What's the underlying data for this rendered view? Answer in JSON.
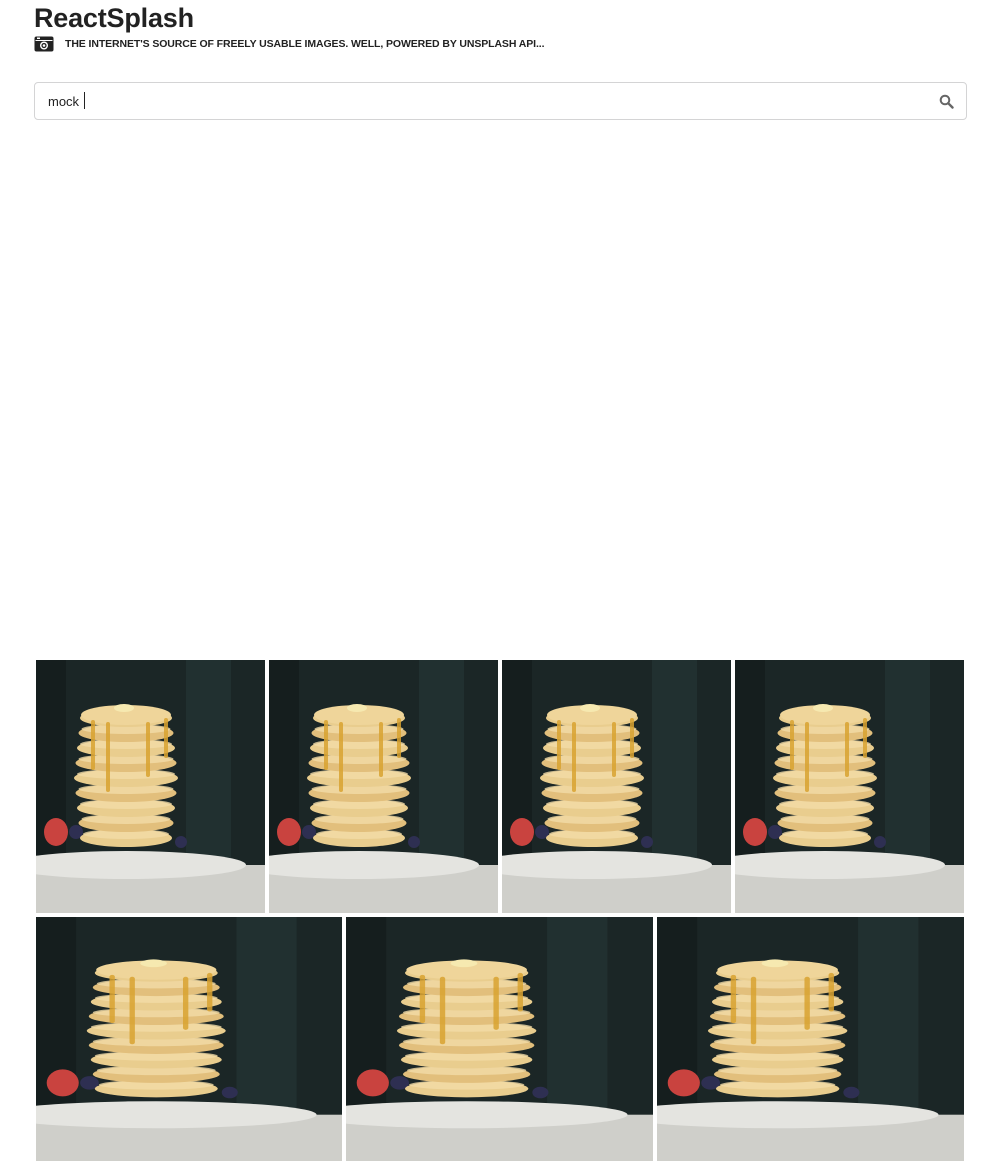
{
  "app": {
    "title": "ReactSplash",
    "tagline": "THE INTERNET'S SOURCE OF FREELY USABLE IMAGES. WELL, POWERED BY UNSPLASH API...",
    "icons": {
      "logo": "camera-icon",
      "search": "search-icon"
    }
  },
  "search": {
    "value": "mock",
    "placeholder": ""
  },
  "gallery": {
    "subject": "pancakes",
    "colors": {
      "background": "#1b2626",
      "pancake": "#e9cd8e",
      "plate": "#e4e4e0",
      "syrup": "#d8a230"
    }
  }
}
